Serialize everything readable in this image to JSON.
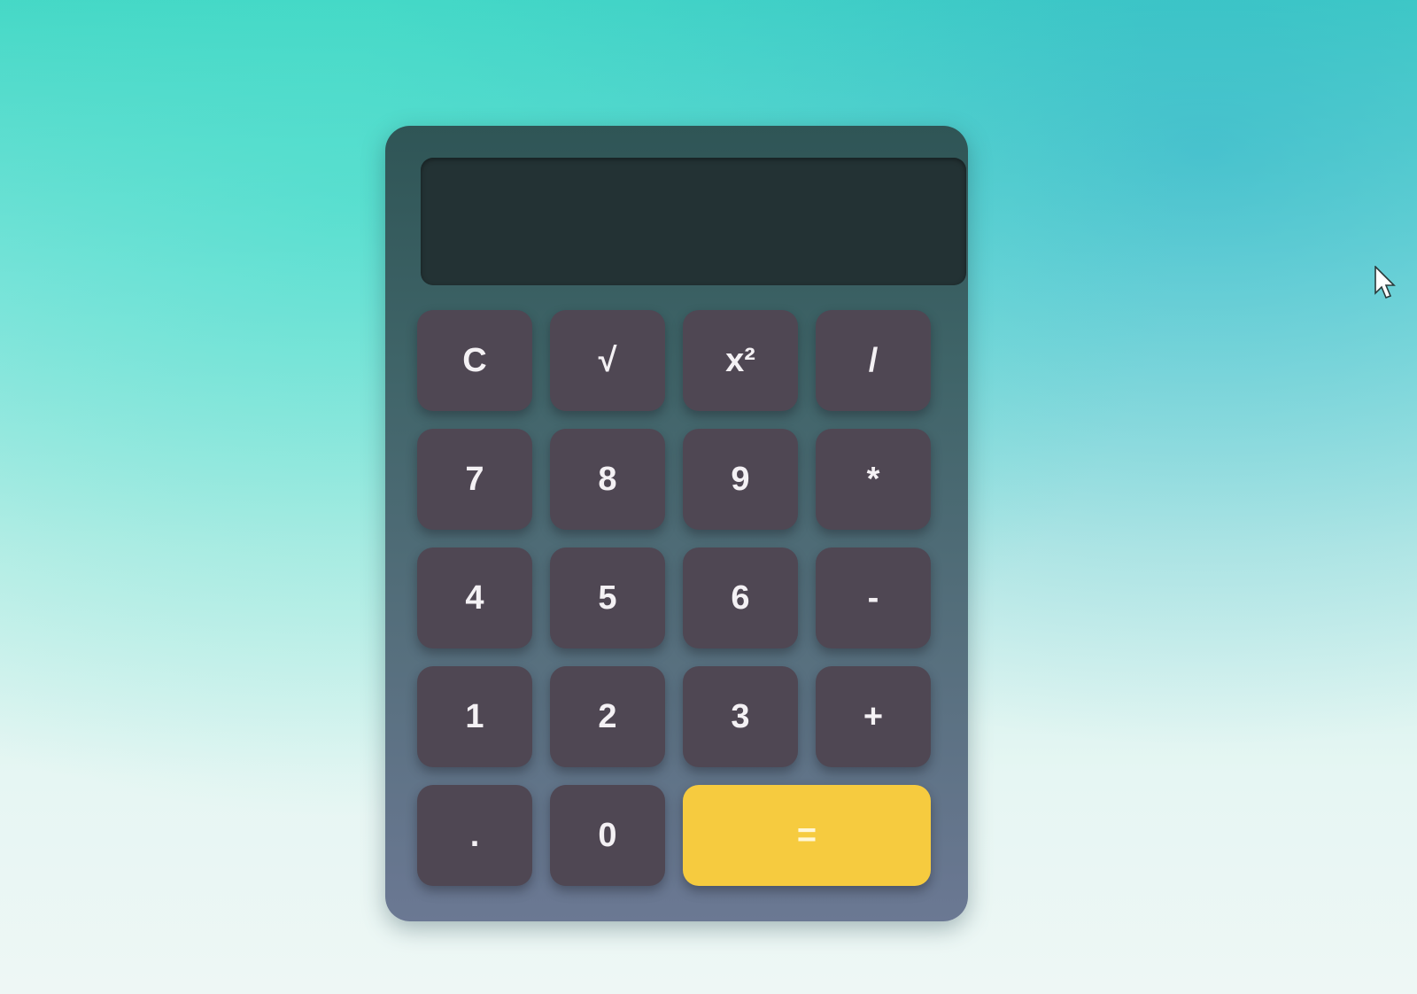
{
  "display": {
    "value": ""
  },
  "keys": [
    {
      "label": "C",
      "name": "clear-button"
    },
    {
      "label": "√",
      "name": "sqrt-button"
    },
    {
      "label": "x²",
      "name": "square-button"
    },
    {
      "label": "/",
      "name": "divide-button"
    },
    {
      "label": "7",
      "name": "digit-7-button"
    },
    {
      "label": "8",
      "name": "digit-8-button"
    },
    {
      "label": "9",
      "name": "digit-9-button"
    },
    {
      "label": "*",
      "name": "multiply-button"
    },
    {
      "label": "4",
      "name": "digit-4-button"
    },
    {
      "label": "5",
      "name": "digit-5-button"
    },
    {
      "label": "6",
      "name": "digit-6-button"
    },
    {
      "label": "-",
      "name": "subtract-button"
    },
    {
      "label": "1",
      "name": "digit-1-button"
    },
    {
      "label": "2",
      "name": "digit-2-button"
    },
    {
      "label": "3",
      "name": "digit-3-button"
    },
    {
      "label": "+",
      "name": "add-button"
    },
    {
      "label": ".",
      "name": "decimal-button"
    },
    {
      "label": "0",
      "name": "digit-0-button"
    },
    {
      "label": "=",
      "name": "equals-button"
    }
  ],
  "colors": {
    "key": "#4f4753",
    "equals": "#f6cb3f",
    "display": "#233234",
    "body": "#3f6468"
  },
  "cursor_icon": "mouse-pointer-icon"
}
